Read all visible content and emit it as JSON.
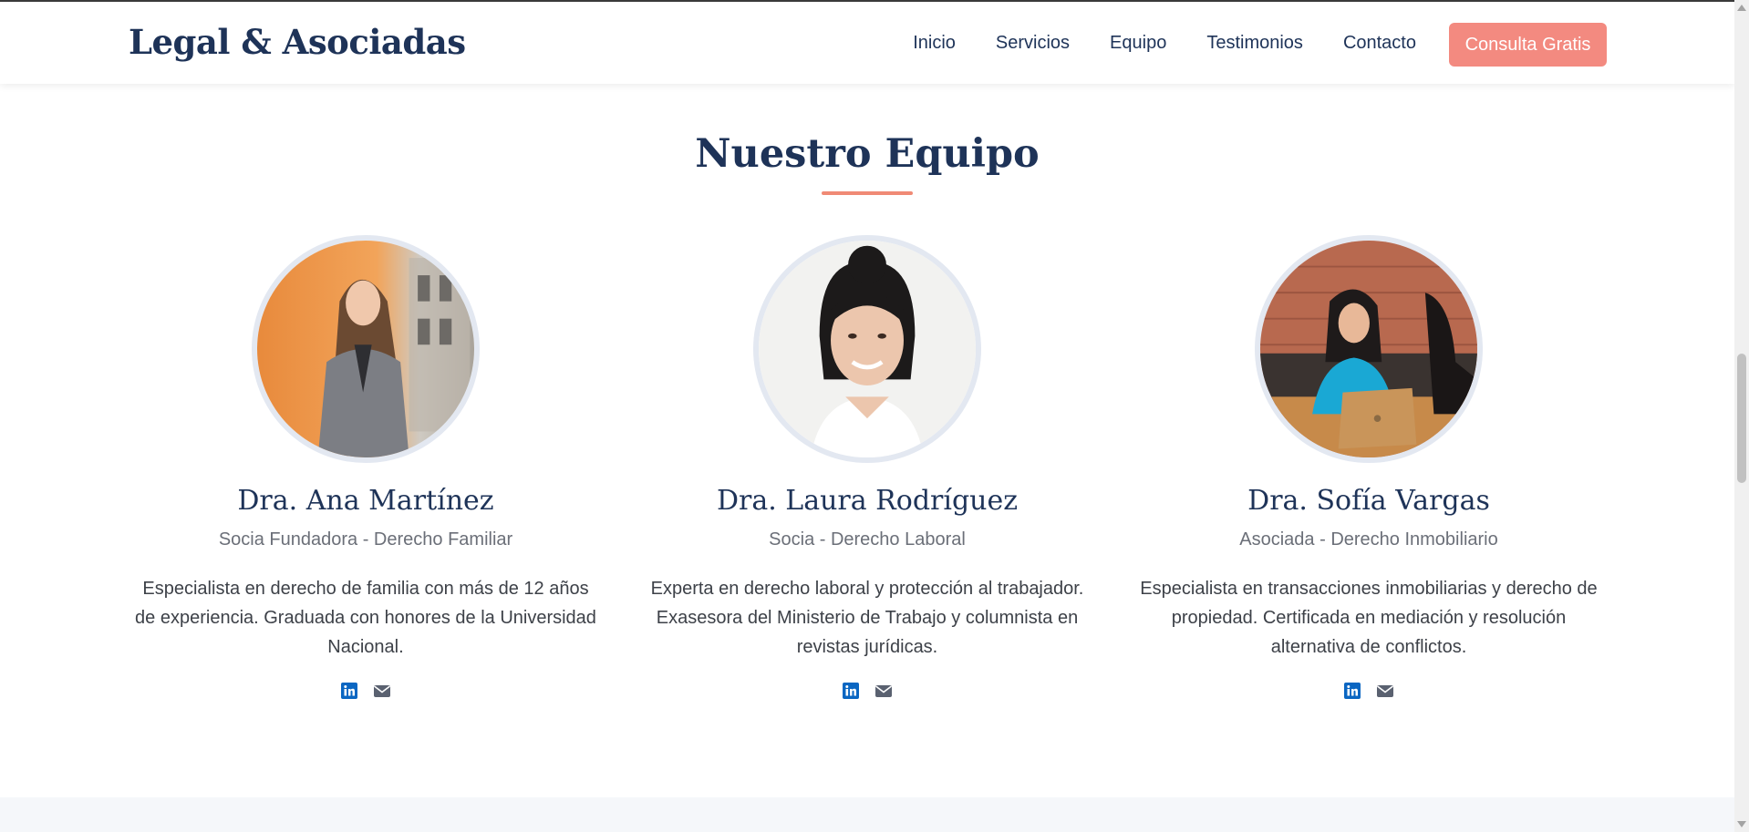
{
  "header": {
    "logo": "Legal & Asociadas",
    "nav": [
      "Inicio",
      "Servicios",
      "Equipo",
      "Testimonios",
      "Contacto"
    ],
    "cta_label": "Consulta Gratis"
  },
  "team": {
    "title": "Nuestro Equipo",
    "members": [
      {
        "name": "Dra. Ana Martínez",
        "role": "Socia Fundadora - Derecho Familiar",
        "bio": "Especialista en derecho de familia con más de 12 años de experiencia. Graduada con honores de la Universidad Nacional."
      },
      {
        "name": "Dra. Laura Rodríguez",
        "role": "Socia - Derecho Laboral",
        "bio": "Experta en derecho laboral y protección al trabajador. Exasesora del Ministerio de Trabajo y columnista en revistas jurídicas."
      },
      {
        "name": "Dra. Sofía Vargas",
        "role": "Asociada - Derecho Inmobiliario",
        "bio": "Especialista en transacciones inmobiliarias y derecho de propiedad. Certificada en mediación y resolución alternativa de conflictos."
      }
    ]
  },
  "colors": {
    "primary": "#1e3358",
    "accent": "#f38a80",
    "linkedin": "#0a66c2",
    "email": "#5a6170"
  },
  "icons": [
    "linkedin-icon",
    "envelope-icon"
  ]
}
